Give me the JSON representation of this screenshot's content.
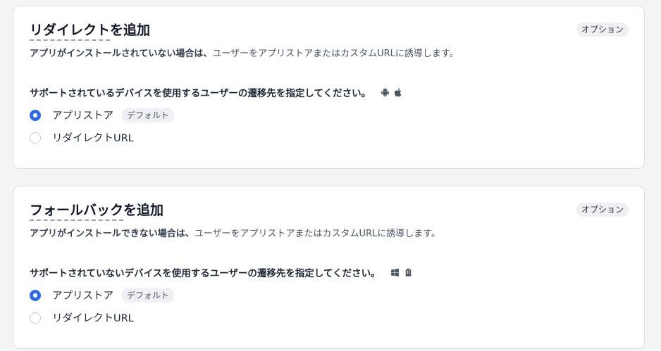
{
  "cards": [
    {
      "title_term": "リダイレクト",
      "title_rest": "を追加",
      "badge": "オプション",
      "subtitle_bold": "アプリがインストールされていない場合は、",
      "subtitle_rest": "ユーザーをアプリストアまたはカスタムURLに誘導します。",
      "question": "サポートされているデバイスを使用するユーザーの遷移先を指定してください。",
      "icons": [
        "android-icon",
        "apple-icon"
      ],
      "options": [
        {
          "label": "アプリストア",
          "badge": "デフォルト",
          "selected": true
        },
        {
          "label": "リダイレクトURL",
          "selected": false
        }
      ]
    },
    {
      "title_term": "フォールバック",
      "title_rest": "を追加",
      "badge": "オプション",
      "subtitle_bold": "アプリがインストールできない場合は、",
      "subtitle_rest": "ユーザーをアプリストアまたはカスタムURLに誘導します。",
      "question": "サポートされていないデバイスを使用するユーザーの遷移先を指定してください。",
      "icons": [
        "windows-icon",
        "blackberry-icon"
      ],
      "options": [
        {
          "label": "アプリストア",
          "badge": "デフォルト",
          "selected": true
        },
        {
          "label": "リダイレクトURL",
          "selected": false
        }
      ]
    }
  ],
  "colors": {
    "accent": "#2d6ae3",
    "badge_bg": "#eef0f3"
  }
}
